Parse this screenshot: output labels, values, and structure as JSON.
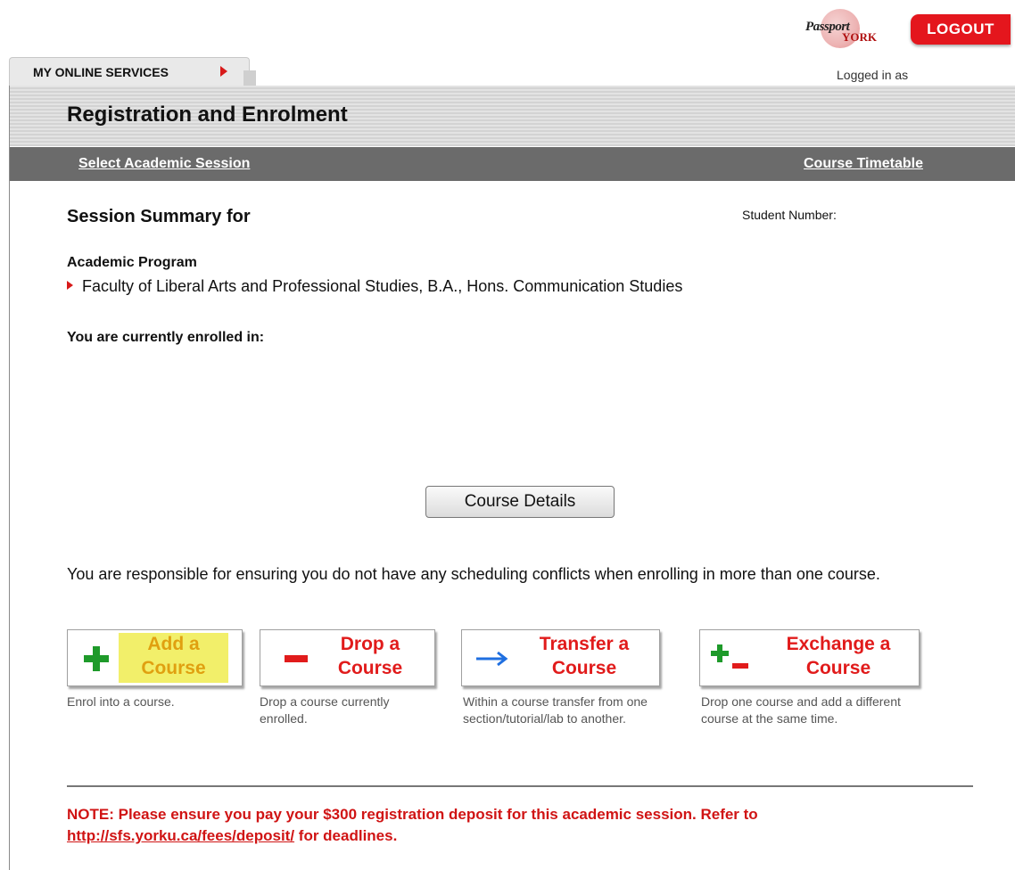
{
  "brand": {
    "logo_text_1": "Passport",
    "logo_text_2": "YORK",
    "logout_label": "LOGOUT"
  },
  "tab": {
    "label": "MY ONLINE SERVICES"
  },
  "logged_in": "Logged in as",
  "header": {
    "title": "Registration and Enrolment"
  },
  "nav": {
    "left_link": "Select Academic Session",
    "right_link": "Course Timetable"
  },
  "session": {
    "title": "Session Summary for",
    "student_number_label": "Student Number:",
    "program_label": "Academic Program",
    "program_value": "Faculty of Liberal Arts and Professional Studies, B.A., Hons. Communication Studies",
    "enrolled_label": "You are currently enrolled in:"
  },
  "course_details_button": "Course Details",
  "warning": "You are responsible for ensuring you do not have any scheduling conflicts when enrolling in more than one course.",
  "actions": [
    {
      "id": "add",
      "label_1": "Add a",
      "label_2": "Course",
      "icon": "plus-icon",
      "description": "Enrol into a course."
    },
    {
      "id": "drop",
      "label_1": "Drop a",
      "label_2": "Course",
      "icon": "minus-icon",
      "description": "Drop a course currently enrolled."
    },
    {
      "id": "transfer",
      "label_1": "Transfer a",
      "label_2": "Course",
      "icon": "arrow-right-icon",
      "description": "Within a course transfer from one section/tutorial/lab to another."
    },
    {
      "id": "exchange",
      "label_1": "Exchange a",
      "label_2": "Course",
      "icon": "exchange-icon",
      "description": "Drop one course and add a different course at the same time."
    }
  ],
  "note": {
    "text_before": "NOTE: Please ensure you pay your $300 registration deposit for this academic session. Refer to ",
    "link": "http://sfs.yorku.ca/fees/deposit/",
    "text_after": " for deadlines."
  },
  "colors": {
    "accent_red": "#e4161d",
    "nav_gray": "#6b6b6b",
    "plus_green": "#1e9a2a",
    "arrow_blue": "#1f6fe0",
    "highlight_yellow": "#f2ef6a"
  }
}
